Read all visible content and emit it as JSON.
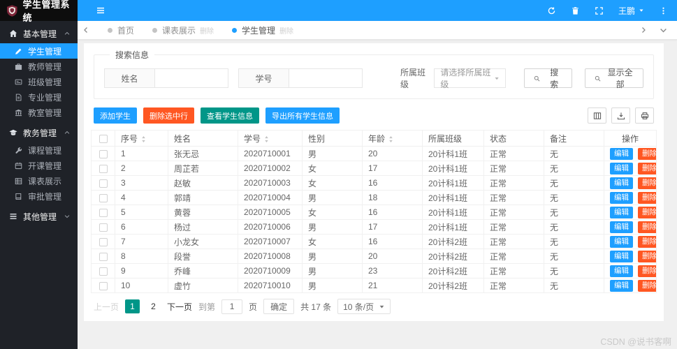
{
  "app": {
    "title": "学生管理系统",
    "logo_icon": "shield-badge-icon"
  },
  "topbar": {
    "username": "王鹏",
    "icons": [
      "menu-hamburger-icon",
      "refresh-icon",
      "clear-cache-icon",
      "fullscreen-icon",
      "caret-down-icon",
      "more-vertical-icon"
    ]
  },
  "tabbar": {
    "tabs": [
      {
        "name": "home",
        "label": "首页",
        "close": "",
        "active": false
      },
      {
        "name": "course-table",
        "label": "课表展示",
        "close": "删除",
        "active": false
      },
      {
        "name": "student-management",
        "label": "学生管理",
        "close": "删除",
        "active": true
      }
    ]
  },
  "sidebar": {
    "groups": [
      {
        "name": "basic-management",
        "label": "基本管理",
        "icon": "home-icon",
        "expanded": true,
        "items": [
          {
            "name": "students",
            "label": "学生管理",
            "icon": "edit-pen-icon",
            "active": true
          },
          {
            "name": "teachers",
            "label": "教师管理",
            "icon": "briefcase-icon",
            "active": false
          },
          {
            "name": "classes",
            "label": "班级管理",
            "icon": "id-card-icon",
            "active": false
          },
          {
            "name": "majors",
            "label": "专业管理",
            "icon": "document-icon",
            "active": false
          },
          {
            "name": "classrooms",
            "label": "教室管理",
            "icon": "building-icon",
            "active": false
          }
        ]
      },
      {
        "name": "academic-management",
        "label": "教务管理",
        "icon": "graduation-cap-icon",
        "expanded": true,
        "items": [
          {
            "name": "courses",
            "label": "课程管理",
            "icon": "wrench-icon",
            "active": false
          },
          {
            "name": "course-offering",
            "label": "开课管理",
            "icon": "calendar-icon",
            "active": false
          },
          {
            "name": "course-table",
            "label": "课表展示",
            "icon": "table-grid-icon",
            "active": false
          },
          {
            "name": "approval",
            "label": "审批管理",
            "icon": "book-icon",
            "active": false
          }
        ]
      },
      {
        "name": "other-management",
        "label": "其他管理",
        "icon": "list-icon",
        "expanded": false,
        "items": []
      }
    ]
  },
  "search": {
    "legend": "搜索信息",
    "name_label": "姓名",
    "name_value": "",
    "sid_label": "学号",
    "sid_value": "",
    "class_label": "所属班级",
    "class_placeholder": "请选择所属班级",
    "search_button": "搜索",
    "show_all_button": "显示全部"
  },
  "toolbar": {
    "buttons": [
      {
        "name": "add-student",
        "label": "添加学生",
        "color": "#1E9FFF"
      },
      {
        "name": "delete-selected-rows",
        "label": "删除选中行",
        "color": "#FF5722"
      },
      {
        "name": "view-student-info",
        "label": "查看学生信息",
        "color": "#009688"
      },
      {
        "name": "export-all-students",
        "label": "导出所有学生信息",
        "color": "#1E9FFF"
      }
    ],
    "tools": [
      "filter-columns-icon",
      "export-icon",
      "print-icon"
    ]
  },
  "table": {
    "columns": [
      {
        "label": "序号",
        "sortable": true
      },
      {
        "label": "姓名",
        "sortable": false
      },
      {
        "label": "学号",
        "sortable": true
      },
      {
        "label": "性别",
        "sortable": false
      },
      {
        "label": "年龄",
        "sortable": true
      },
      {
        "label": "所属班级",
        "sortable": false
      },
      {
        "label": "状态",
        "sortable": false
      },
      {
        "label": "备注",
        "sortable": false
      },
      {
        "label": "操作",
        "sortable": false
      }
    ],
    "edit_label": "编辑",
    "delete_label": "删除",
    "rows": [
      [
        "1",
        "张无忌",
        "2020710001",
        "男",
        "20",
        "20计科1班",
        "正常",
        "无"
      ],
      [
        "2",
        "周芷若",
        "2020710002",
        "女",
        "17",
        "20计科1班",
        "正常",
        "无"
      ],
      [
        "3",
        "赵敏",
        "2020710003",
        "女",
        "16",
        "20计科1班",
        "正常",
        "无"
      ],
      [
        "4",
        "郭靖",
        "2020710004",
        "男",
        "18",
        "20计科1班",
        "正常",
        "无"
      ],
      [
        "5",
        "黄蓉",
        "2020710005",
        "女",
        "16",
        "20计科1班",
        "正常",
        "无"
      ],
      [
        "6",
        "杨过",
        "2020710006",
        "男",
        "17",
        "20计科1班",
        "正常",
        "无"
      ],
      [
        "7",
        "小龙女",
        "2020710007",
        "女",
        "16",
        "20计科2班",
        "正常",
        "无"
      ],
      [
        "8",
        "段誉",
        "2020710008",
        "男",
        "20",
        "20计科2班",
        "正常",
        "无"
      ],
      [
        "9",
        "乔峰",
        "2020710009",
        "男",
        "23",
        "20计科2班",
        "正常",
        "无"
      ],
      [
        "10",
        "虚竹",
        "2020710010",
        "男",
        "21",
        "20计科2班",
        "正常",
        "无"
      ]
    ]
  },
  "pagination": {
    "prev": "上一页",
    "pages": [
      "1",
      "2"
    ],
    "active_page": "1",
    "next": "下一页",
    "goto_label": "到第",
    "goto_value": "1",
    "page_unit": "页",
    "confirm": "确定",
    "total": "共 17 条",
    "page_size": "10 条/页"
  },
  "watermark": "CSDN @说书客啊",
  "colors": {
    "accent_blue": "#1E9FFF",
    "danger_red": "#FF5722",
    "teal_green": "#009688",
    "sidebar_bg": "#1F2228",
    "logo_bg": "#0D0D0D",
    "content_bg": "#F0F0F0"
  }
}
